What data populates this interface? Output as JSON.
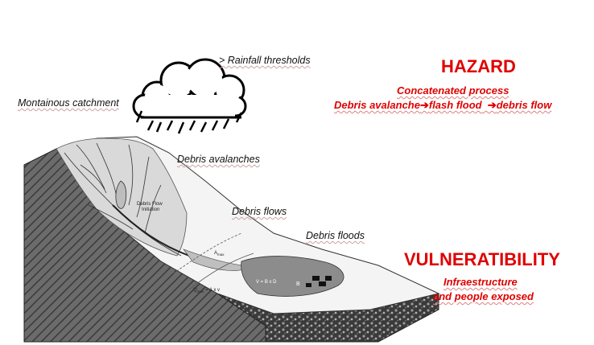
{
  "labels": {
    "rainfall": "> Rainfall thresholds",
    "catchment": "Montainous catchment",
    "avalanches": "Debris avalanches",
    "flows": "Debris flows",
    "floods": "Debris floods"
  },
  "diagram_text": {
    "initiation_line1": "Debris Flow",
    "initiation_line2": "Initiation",
    "qmax": "Q",
    "qmax_sub": "max",
    "formula": "= A x v",
    "amax": "A",
    "amax_sub": "max",
    "volume": "V = B x D",
    "zone_b": "B"
  },
  "hazard": {
    "title": "HAZARD",
    "line1": "Concatenated process",
    "line2_a": "Debris avalanche",
    "line2_b": "flash flood",
    "line2_c": "debris flow",
    "arrow": "➔"
  },
  "vulnerability": {
    "title": "VULNERATIBILITY",
    "line1": "Infraestructure",
    "line2": "and people exposed"
  },
  "colors": {
    "accent": "#e00000",
    "hillslope": "#d9d9d9",
    "cliff": "#4d4d4d",
    "fan": "#8c8c8c"
  }
}
